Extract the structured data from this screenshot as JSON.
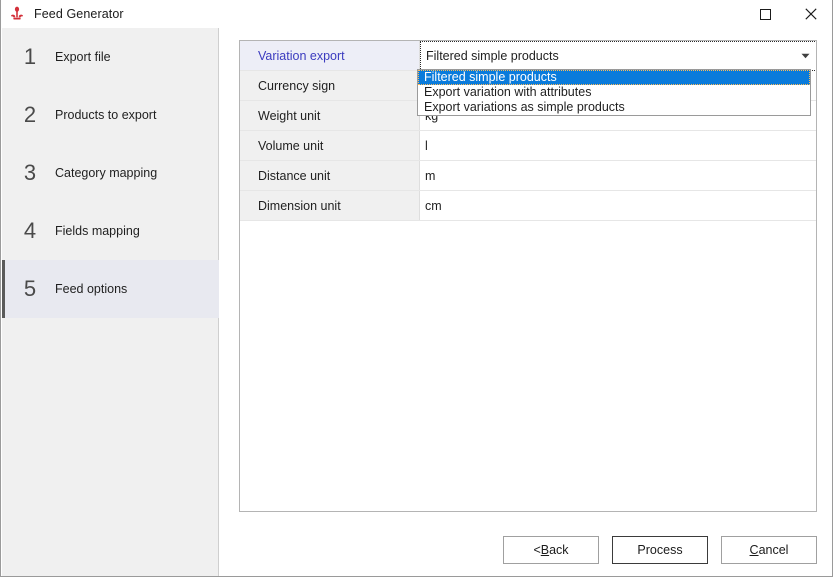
{
  "window": {
    "title": "Feed Generator",
    "icon": "feed-generator-icon",
    "controls": {
      "maximize": "maximize-icon",
      "close": "close-icon"
    }
  },
  "sidebar": {
    "items": [
      {
        "num": "1",
        "label": "Export file",
        "selected": false
      },
      {
        "num": "2",
        "label": "Products to export",
        "selected": false
      },
      {
        "num": "3",
        "label": "Category mapping",
        "selected": false
      },
      {
        "num": "4",
        "label": "Fields mapping",
        "selected": false
      },
      {
        "num": "5",
        "label": "Feed options",
        "selected": true
      }
    ]
  },
  "properties": {
    "rows": [
      {
        "label": "Variation export",
        "value": "Filtered simple products",
        "active": true
      },
      {
        "label": "Currency sign",
        "value": "",
        "active": false
      },
      {
        "label": "Weight unit",
        "value": "kg",
        "active": false
      },
      {
        "label": "Volume unit",
        "value": "l",
        "active": false
      },
      {
        "label": "Distance unit",
        "value": "m",
        "active": false
      },
      {
        "label": "Dimension unit",
        "value": "cm",
        "active": false
      }
    ]
  },
  "dropdown": {
    "open": true,
    "selected_index": 0,
    "options": [
      "Filtered simple products",
      "Export variation with attributes",
      "Export variations as simple products"
    ]
  },
  "footer": {
    "back_button": "< Back",
    "back_button_pre": "< ",
    "back_button_accel": "B",
    "back_button_post": "ack",
    "process_button": "Process",
    "cancel_button": "Cancel",
    "cancel_button_accel": "C",
    "cancel_button_post": "ancel"
  },
  "colors": {
    "accent_blue": "#0a7bdb",
    "active_label_text": "#3b3bbf",
    "active_label_bg": "#edeef7",
    "sidebar_bg": "#f0f0f0",
    "selected_step_bg": "#e8e9f0",
    "icon_red": "#d3303a"
  }
}
